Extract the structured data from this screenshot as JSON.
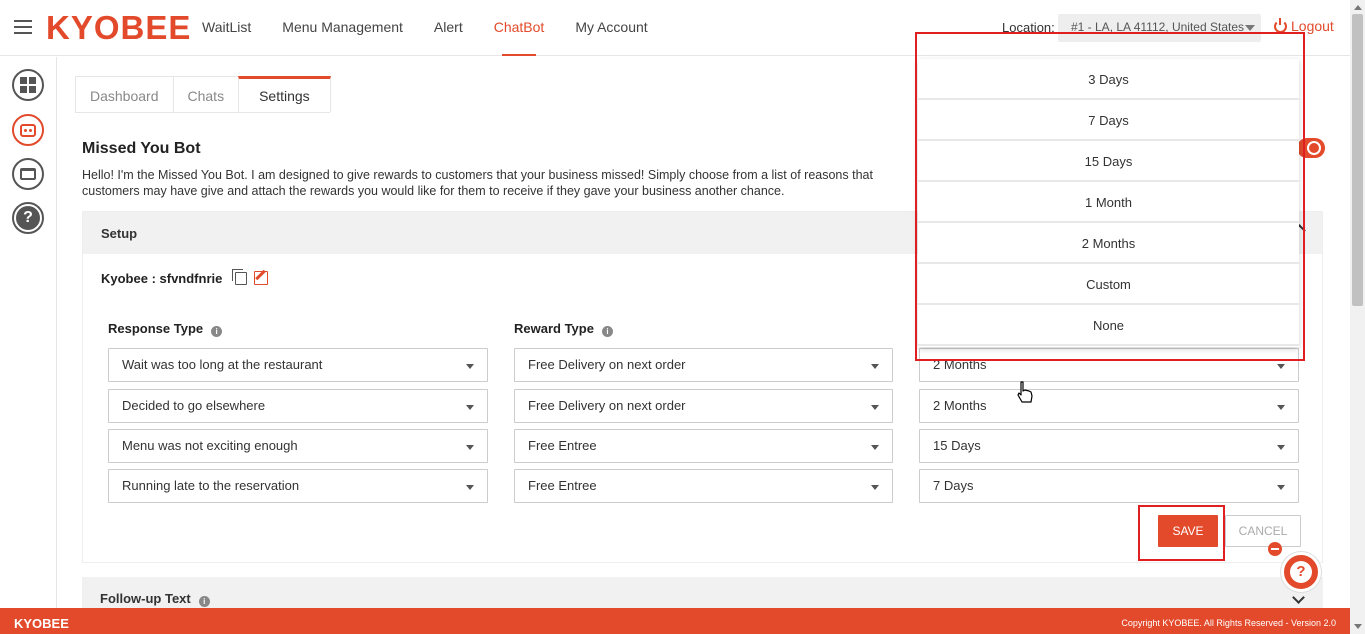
{
  "header": {
    "brand": "KYOBEE",
    "nav": [
      "WaitList",
      "Menu Management",
      "Alert",
      "ChatBot",
      "My Account"
    ],
    "active_nav": "ChatBot",
    "location_label": "Location:",
    "location_value": "#1 - LA, LA 41112, United States",
    "logout_label": "Logout"
  },
  "sidebar": {
    "icons": [
      "dashboard-icon",
      "chatbot-icon",
      "cake-icon",
      "help-icon"
    ]
  },
  "tabs": [
    "Dashboard",
    "Chats",
    "Settings"
  ],
  "active_tab": "Settings",
  "bot": {
    "title": "Missed You Bot",
    "intro": "Hello! I'm the Missed You Bot. I am designed to give rewards to customers that your business missed! Simply choose from a list of reasons that customers may have give and attach the rewards you would like for them to receive if they gave your business another chance.",
    "setup_label": "Setup",
    "name_label": "Kyobee : sfvndfnrie",
    "response_type_label": "Response Type",
    "reward_type_label": "Reward Type",
    "info_glyph": "i",
    "rows": [
      {
        "response": "Wait was too long at the restaurant",
        "reward": "Free Delivery on next order",
        "duration": "2 Months"
      },
      {
        "response": "Decided to go elsewhere",
        "reward": "Free Delivery on next order",
        "duration": "2 Months"
      },
      {
        "response": "Menu was not exciting enough",
        "reward": "Free Entree",
        "duration": "15 Days"
      },
      {
        "response": "Running late to the reservation",
        "reward": "Free Entree",
        "duration": "7 Days"
      }
    ],
    "save_label": "SAVE",
    "cancel_label": "CANCEL",
    "followup_label": "Follow-up Text"
  },
  "duration_menu": [
    "3 Days",
    "7 Days",
    "15 Days",
    "1 Month",
    "2 Months",
    "Custom",
    "None"
  ],
  "help_glyph": "?",
  "footer": {
    "brand": "KYOBEE",
    "copyright": "Copyright KYOBEE. All Rights Reserved - Version 2.0"
  },
  "colors": {
    "accent": "#e24a2b",
    "highlight_outline": "#e02020"
  }
}
